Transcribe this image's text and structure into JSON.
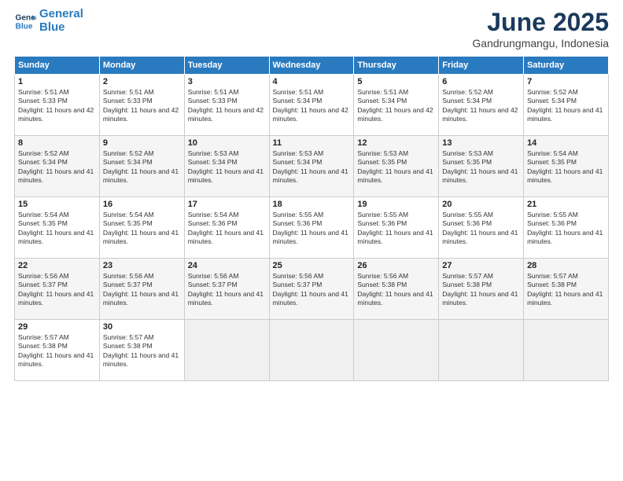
{
  "logo": {
    "line1": "General",
    "line2": "Blue"
  },
  "title": {
    "month_year": "June 2025",
    "location": "Gandrungmangu, Indonesia"
  },
  "weekdays": [
    "Sunday",
    "Monday",
    "Tuesday",
    "Wednesday",
    "Thursday",
    "Friday",
    "Saturday"
  ],
  "weeks": [
    [
      {
        "day": 1,
        "sunrise": "5:51 AM",
        "sunset": "5:33 PM",
        "daylight": "11 hours and 42 minutes."
      },
      {
        "day": 2,
        "sunrise": "5:51 AM",
        "sunset": "5:33 PM",
        "daylight": "11 hours and 42 minutes."
      },
      {
        "day": 3,
        "sunrise": "5:51 AM",
        "sunset": "5:33 PM",
        "daylight": "11 hours and 42 minutes."
      },
      {
        "day": 4,
        "sunrise": "5:51 AM",
        "sunset": "5:34 PM",
        "daylight": "11 hours and 42 minutes."
      },
      {
        "day": 5,
        "sunrise": "5:51 AM",
        "sunset": "5:34 PM",
        "daylight": "11 hours and 42 minutes."
      },
      {
        "day": 6,
        "sunrise": "5:52 AM",
        "sunset": "5:34 PM",
        "daylight": "11 hours and 42 minutes."
      },
      {
        "day": 7,
        "sunrise": "5:52 AM",
        "sunset": "5:34 PM",
        "daylight": "11 hours and 41 minutes."
      }
    ],
    [
      {
        "day": 8,
        "sunrise": "5:52 AM",
        "sunset": "5:34 PM",
        "daylight": "11 hours and 41 minutes."
      },
      {
        "day": 9,
        "sunrise": "5:52 AM",
        "sunset": "5:34 PM",
        "daylight": "11 hours and 41 minutes."
      },
      {
        "day": 10,
        "sunrise": "5:53 AM",
        "sunset": "5:34 PM",
        "daylight": "11 hours and 41 minutes."
      },
      {
        "day": 11,
        "sunrise": "5:53 AM",
        "sunset": "5:34 PM",
        "daylight": "11 hours and 41 minutes."
      },
      {
        "day": 12,
        "sunrise": "5:53 AM",
        "sunset": "5:35 PM",
        "daylight": "11 hours and 41 minutes."
      },
      {
        "day": 13,
        "sunrise": "5:53 AM",
        "sunset": "5:35 PM",
        "daylight": "11 hours and 41 minutes."
      },
      {
        "day": 14,
        "sunrise": "5:54 AM",
        "sunset": "5:35 PM",
        "daylight": "11 hours and 41 minutes."
      }
    ],
    [
      {
        "day": 15,
        "sunrise": "5:54 AM",
        "sunset": "5:35 PM",
        "daylight": "11 hours and 41 minutes."
      },
      {
        "day": 16,
        "sunrise": "5:54 AM",
        "sunset": "5:35 PM",
        "daylight": "11 hours and 41 minutes."
      },
      {
        "day": 17,
        "sunrise": "5:54 AM",
        "sunset": "5:36 PM",
        "daylight": "11 hours and 41 minutes."
      },
      {
        "day": 18,
        "sunrise": "5:55 AM",
        "sunset": "5:36 PM",
        "daylight": "11 hours and 41 minutes."
      },
      {
        "day": 19,
        "sunrise": "5:55 AM",
        "sunset": "5:36 PM",
        "daylight": "11 hours and 41 minutes."
      },
      {
        "day": 20,
        "sunrise": "5:55 AM",
        "sunset": "5:36 PM",
        "daylight": "11 hours and 41 minutes."
      },
      {
        "day": 21,
        "sunrise": "5:55 AM",
        "sunset": "5:36 PM",
        "daylight": "11 hours and 41 minutes."
      }
    ],
    [
      {
        "day": 22,
        "sunrise": "5:56 AM",
        "sunset": "5:37 PM",
        "daylight": "11 hours and 41 minutes."
      },
      {
        "day": 23,
        "sunrise": "5:56 AM",
        "sunset": "5:37 PM",
        "daylight": "11 hours and 41 minutes."
      },
      {
        "day": 24,
        "sunrise": "5:56 AM",
        "sunset": "5:37 PM",
        "daylight": "11 hours and 41 minutes."
      },
      {
        "day": 25,
        "sunrise": "5:56 AM",
        "sunset": "5:37 PM",
        "daylight": "11 hours and 41 minutes."
      },
      {
        "day": 26,
        "sunrise": "5:56 AM",
        "sunset": "5:38 PM",
        "daylight": "11 hours and 41 minutes."
      },
      {
        "day": 27,
        "sunrise": "5:57 AM",
        "sunset": "5:38 PM",
        "daylight": "11 hours and 41 minutes."
      },
      {
        "day": 28,
        "sunrise": "5:57 AM",
        "sunset": "5:38 PM",
        "daylight": "11 hours and 41 minutes."
      }
    ],
    [
      {
        "day": 29,
        "sunrise": "5:57 AM",
        "sunset": "5:38 PM",
        "daylight": "11 hours and 41 minutes."
      },
      {
        "day": 30,
        "sunrise": "5:57 AM",
        "sunset": "5:38 PM",
        "daylight": "11 hours and 41 minutes."
      },
      null,
      null,
      null,
      null,
      null
    ]
  ]
}
